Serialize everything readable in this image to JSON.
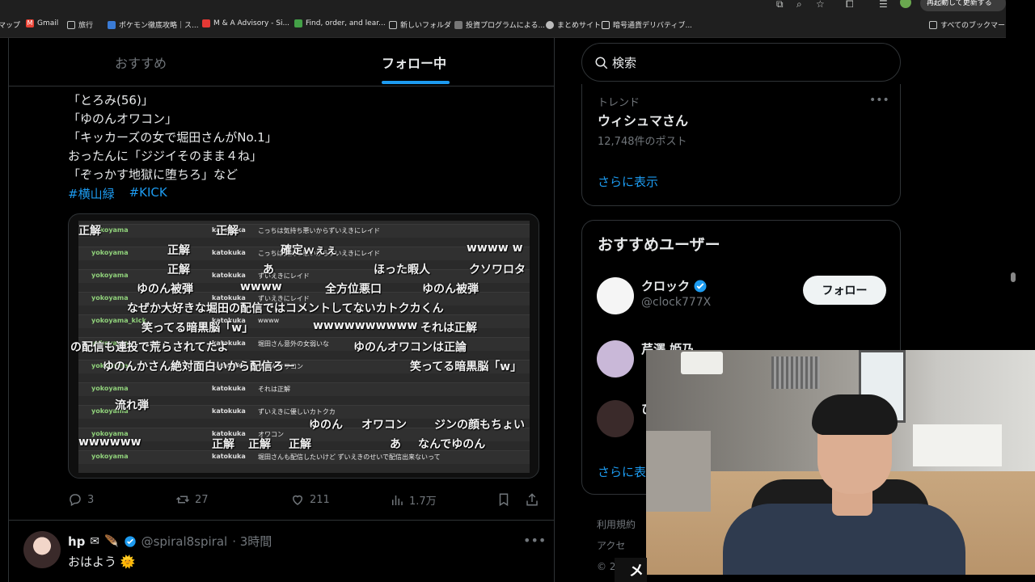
{
  "browser": {
    "relaunch_label": "再起動して更新する",
    "bookmarks": [
      {
        "label": "マップ",
        "icon": "map-icon",
        "color": "#4285f4"
      },
      {
        "label": "Gmail",
        "icon": "gmail-icon",
        "color": "#ea4335"
      },
      {
        "label": "旅行",
        "icon": "folder-icon",
        "color": "#c4c7c5"
      },
      {
        "label": "ポケモン徹底攻略｜ス...",
        "icon": "site-icon",
        "color": "#3a7bd5"
      },
      {
        "label": "M & A Advisory - Si...",
        "icon": "site-icon",
        "color": "#e53935"
      },
      {
        "label": "Find, order, and lear...",
        "icon": "site-icon",
        "color": "#43a047"
      },
      {
        "label": "新しいフォルダ",
        "icon": "folder-icon",
        "color": "#c4c7c5"
      },
      {
        "label": "投資プログラムによる...",
        "icon": "site-icon",
        "color": "#777777"
      },
      {
        "label": "まとめサイト",
        "icon": "globe-icon",
        "color": "#bbbbbb"
      },
      {
        "label": "暗号通貨デリバティブ...",
        "icon": "site-icon",
        "color": "#222222"
      },
      {
        "label": "すべてのブックマーク",
        "icon": "folder-icon",
        "color": "#c4c7c5"
      }
    ]
  },
  "timeline": {
    "tabs": [
      {
        "label": "おすすめ",
        "active": false
      },
      {
        "label": "フォロー中",
        "active": true
      }
    ],
    "post": {
      "lines": [
        "「とろみ(56)」",
        "「ゆのんオワコン」",
        "「キッカーズの女で堀田さんがNo.1」",
        "おったんに「ジジイそのまま４ね」",
        "「ぞっかす地獄に堕ちろ」など"
      ],
      "hashtags": [
        "#横山緑",
        "#KICK"
      ],
      "media": {
        "chat_rows": [
          {
            "user": "yokoyama",
            "user2": "katokuka",
            "msg": "こっちは気持ち悪いからずいえきにレイド"
          },
          {
            "user": "yokoyama",
            "user2": "katokuka",
            "msg": "こっちは気持ち悪いからずいえきにレイド"
          },
          {
            "user": "yokoyama",
            "user2": "katokuka",
            "msg": "ずいえきにレイド"
          },
          {
            "user": "yokoyama",
            "user2": "katokuka",
            "msg": "ずいえきにレイド"
          },
          {
            "user": "yokoyama_kick",
            "user2": "katokuka",
            "msg": "wwww"
          },
          {
            "user": "yokoyama",
            "user2": "katokuka",
            "msg": "堀田さん意外の女弱いな"
          },
          {
            "user": "yokoyama",
            "user2": "katokuka",
            "msg": "ゆのんオワコン"
          },
          {
            "user": "yokoyama",
            "user2": "katokuka",
            "msg": "それは正解"
          },
          {
            "user": "yokoyama",
            "user2": "katokuka",
            "msg": "ずいえきに優しいカトクカ"
          },
          {
            "user": "yokoyama",
            "user2": "katokuka",
            "msg": "オワコン"
          },
          {
            "user": "yokoyama",
            "user2": "katokuka",
            "msg": "堀田さんも配信したいけど ずいえきのせいで配信出来ないって"
          }
        ],
        "danmaku": [
          "正解",
          "正解",
          "正解",
          "確定ｗぇぇ",
          "wwww w",
          "正解",
          "あ",
          "ほった暇人",
          "クソワロタ",
          "ゆのん被弾",
          "wwww",
          "全方位悪口",
          "ゆのん被弾",
          "なぜか大好きな堀田の配信ではコメントしてないカトクカくん",
          "笑ってる暗黒脳「w」",
          "wwwwwwwwww",
          "それは正解",
          "の配信も連投で荒らされてたよ",
          "ゆのんオワコンは正論",
          "ゆのんかさん絶対面白いから配信ろー",
          "笑ってる暗黒脳「w」",
          "流れ弾",
          "ゆのん",
          "オワコン",
          "ジンの顔もちょい",
          "wwwwww",
          "正解",
          "正解",
          "正解",
          "あ",
          "なんでゆのん"
        ]
      },
      "actions": {
        "replies": "3",
        "reposts": "27",
        "likes": "211",
        "views": "1.7万"
      }
    },
    "post2": {
      "name": "hp",
      "handle": "@spiral8spiral",
      "time": "· 3時間",
      "text": "おはよう"
    }
  },
  "sidebar": {
    "search_placeholder": "検索",
    "trend": {
      "label": "トレンド",
      "title": "ウィシュマさん",
      "count": "12,748件のポスト",
      "show_more": "さらに表示"
    },
    "who_to_follow": {
      "title": "おすすめユーザー",
      "users": [
        {
          "name": "クロック",
          "handle": "@clock777X",
          "verified": true,
          "button": "フォロー",
          "avatar_color": "#f5f5f5"
        },
        {
          "name": "芹澤 姫乃",
          "handle": "",
          "verified": false,
          "button": "",
          "avatar_color": "#c9b8d8"
        },
        {
          "name": "ひ",
          "handle": "",
          "verified": false,
          "button": "",
          "avatar_color": "#3a2a2a"
        }
      ],
      "show_more": "さらに表"
    },
    "footer": [
      "利用規約",
      "アクセ",
      "© 2"
    ]
  },
  "overlay": {
    "bottom_glyph": "メ"
  },
  "colors": {
    "accent": "#1d9bf0",
    "background": "#000000",
    "border": "#2f3336",
    "muted": "#71767b"
  }
}
